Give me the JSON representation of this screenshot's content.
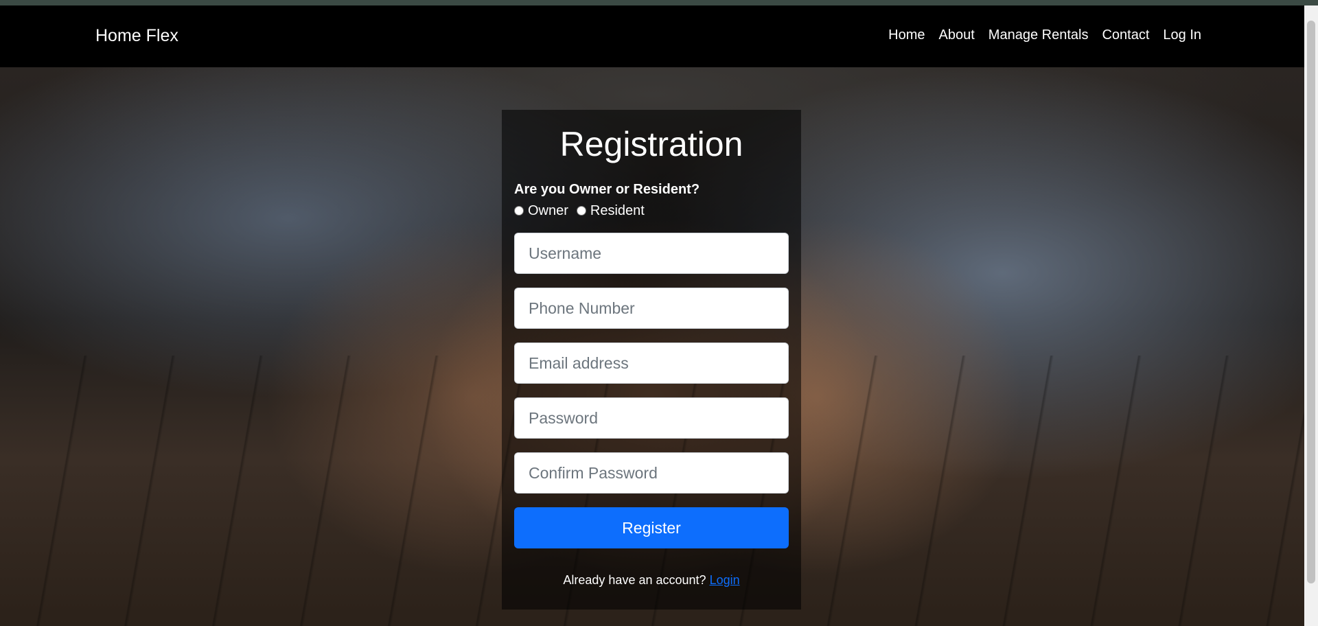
{
  "navbar": {
    "brand": "Home Flex",
    "links": [
      "Home",
      "About",
      "Manage Rentals",
      "Contact",
      "Log In"
    ]
  },
  "form": {
    "title": "Registration",
    "question": "Are you Owner or Resident?",
    "options": [
      "Owner",
      "Resident"
    ],
    "fields": {
      "username": "Username",
      "phone": "Phone Number",
      "email": "Email address",
      "password": "Password",
      "confirm_password": "Confirm Password"
    },
    "submit_label": "Register",
    "login_prompt": "Already have an account?",
    "login_link": "Login"
  },
  "colors": {
    "navbar": "#000000",
    "button": "#0d6efd",
    "link": "#0d6efd"
  }
}
